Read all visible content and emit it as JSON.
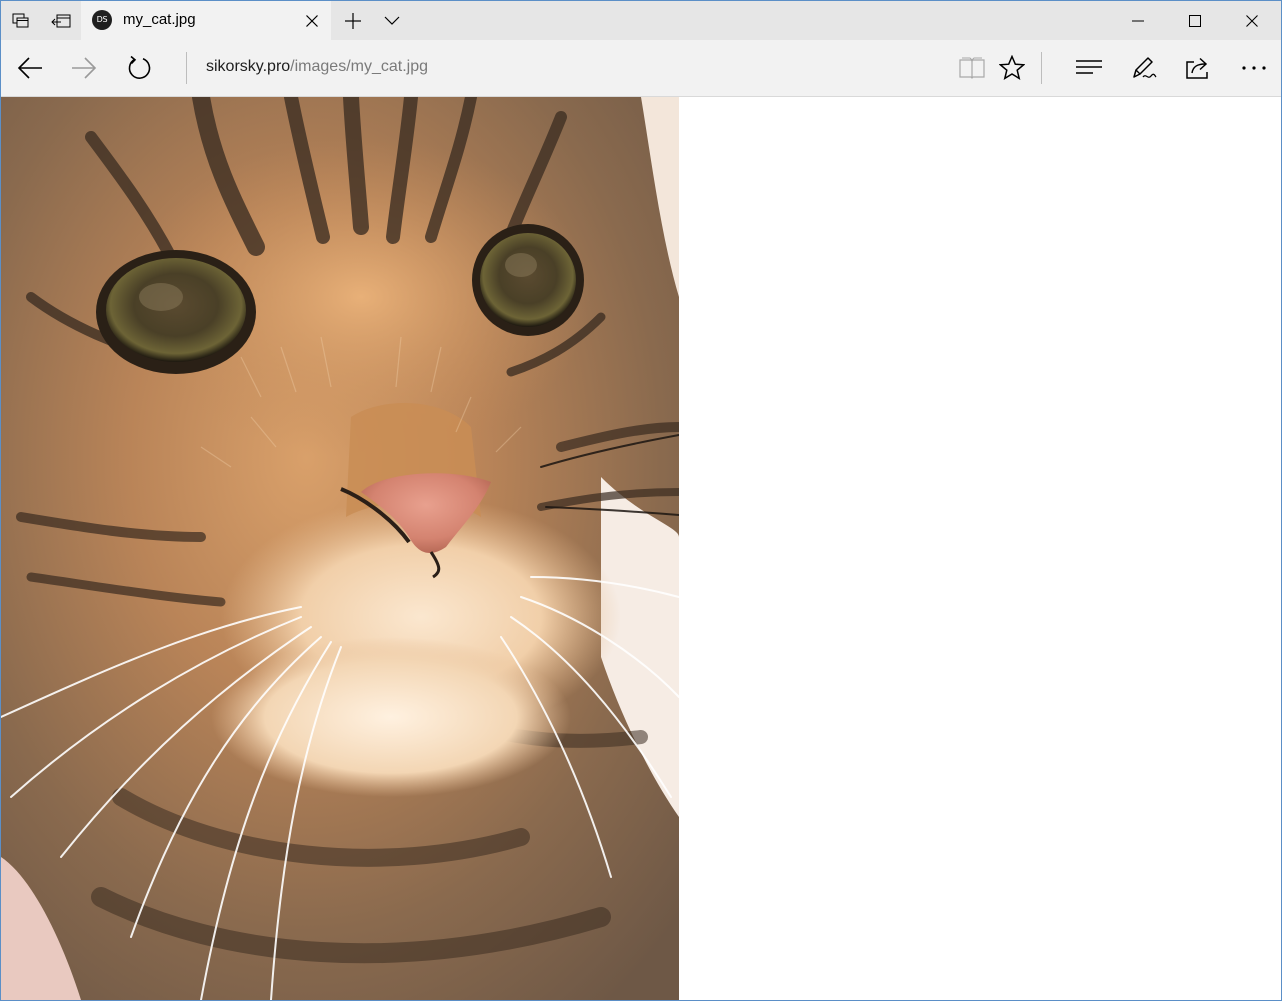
{
  "window": {
    "accent_border": "#5b8fc7"
  },
  "titlebar": {
    "tabs_aside_icon": "tab-list-icon",
    "set_aside_icon": "set-aside-tabs-icon",
    "new_tab_icon": "plus-icon",
    "tab_menu_icon": "chevron-down-icon",
    "minimize_icon": "minimize-icon",
    "maximize_icon": "maximize-icon",
    "close_icon": "close-icon"
  },
  "tab": {
    "favicon_text": "DS",
    "title": "my_cat.jpg"
  },
  "navbar": {
    "address_domain": "sikorsky.pro",
    "address_path": "/images/my_cat.jpg",
    "back_icon": "arrow-left-icon",
    "forward_icon": "arrow-right-icon",
    "refresh_icon": "refresh-icon",
    "reading_view_icon": "book-icon",
    "favorite_icon": "star-icon",
    "hub_icon": "hub-lines-icon",
    "notes_icon": "pen-icon",
    "share_icon": "share-icon",
    "more_icon": "ellipsis-icon"
  },
  "content": {
    "image_subject": "tabby-cat-photo",
    "background": "#ffffff"
  }
}
